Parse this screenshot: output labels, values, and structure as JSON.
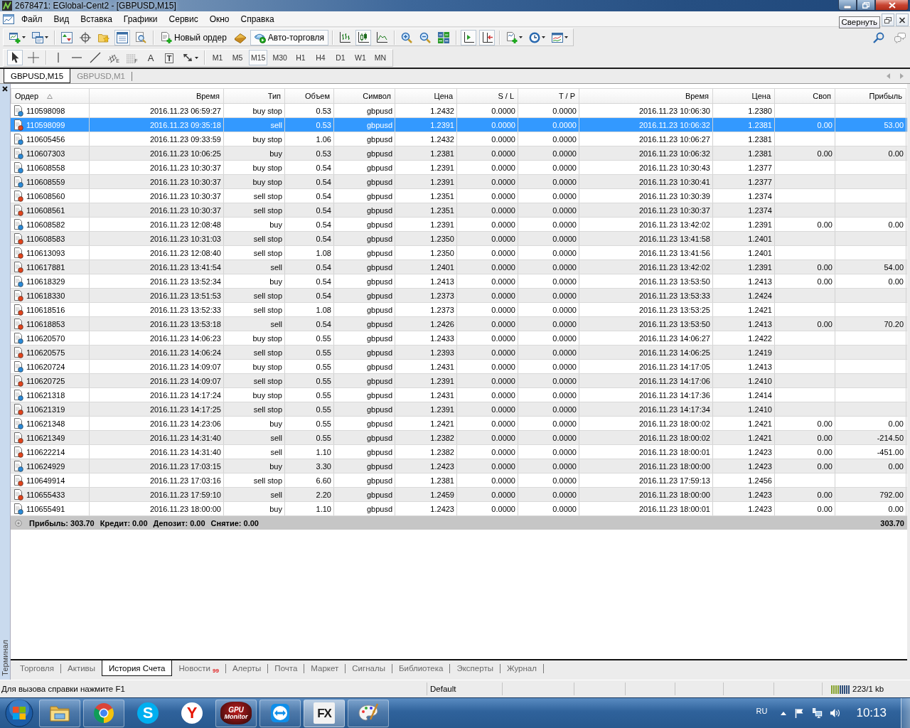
{
  "window": {
    "title": "2678471: EGlobal-Cent2 - [GBPUSD,M15]"
  },
  "menu": {
    "items": [
      "Файл",
      "Вид",
      "Вставка",
      "Графики",
      "Сервис",
      "Окно",
      "Справка"
    ],
    "tooltip": "Свернуть"
  },
  "toolbar": {
    "groups": [
      [
        {
          "kind": "new-chart",
          "pressed": false,
          "dropdown": true
        },
        {
          "kind": "profiles",
          "pressed": false,
          "dropdown": true
        }
      ],
      [
        {
          "kind": "market-watch",
          "pressed": false
        },
        {
          "kind": "data-window",
          "pressed": false
        },
        {
          "kind": "navigator",
          "pressed": false
        },
        {
          "kind": "terminal",
          "pressed": true
        },
        {
          "kind": "tester",
          "pressed": false
        }
      ],
      [
        {
          "kind": "new-order",
          "label": "Новый ордер",
          "pressed": false
        },
        {
          "kind": "editor",
          "pressed": false
        },
        {
          "kind": "autotrading",
          "label": "Авто-торговля",
          "pressed": true
        }
      ],
      [
        {
          "kind": "bars",
          "pressed": false
        },
        {
          "kind": "candles",
          "pressed": true
        },
        {
          "kind": "line",
          "pressed": false
        }
      ],
      [
        {
          "kind": "zoom-in",
          "pressed": false
        },
        {
          "kind": "zoom-out",
          "pressed": false
        },
        {
          "kind": "tile",
          "pressed": false
        }
      ],
      [
        {
          "kind": "shift",
          "pressed": true
        },
        {
          "kind": "autoscroll",
          "pressed": true
        }
      ],
      [
        {
          "kind": "indicators",
          "pressed": false,
          "dropdown": true
        },
        {
          "kind": "periods",
          "pressed": false,
          "dropdown": true
        },
        {
          "kind": "templates",
          "pressed": false,
          "dropdown": true
        }
      ]
    ],
    "right": [
      {
        "kind": "search"
      },
      {
        "kind": "chat"
      }
    ]
  },
  "drawing_toolbar": {
    "groups": [
      [
        {
          "kind": "cursor",
          "selected": true
        },
        {
          "kind": "crosshair",
          "selected": false
        }
      ],
      [
        {
          "kind": "vline",
          "selected": false
        },
        {
          "kind": "hline",
          "selected": false
        },
        {
          "kind": "trendline",
          "selected": false
        },
        {
          "kind": "channel",
          "letter": "E",
          "selected": false
        },
        {
          "kind": "fibo",
          "letter": "F",
          "selected": false
        },
        {
          "kind": "text",
          "letter": "A",
          "selected": false
        },
        {
          "kind": "label",
          "letter": "T",
          "selected": false
        },
        {
          "kind": "arrows",
          "selected": false,
          "dropdown": true
        }
      ]
    ],
    "timeframes": [
      {
        "label": "M1",
        "selected": false
      },
      {
        "label": "M5",
        "selected": false
      },
      {
        "label": "M15",
        "selected": true
      },
      {
        "label": "M30",
        "selected": false
      },
      {
        "label": "H1",
        "selected": false
      },
      {
        "label": "H4",
        "selected": false
      },
      {
        "label": "D1",
        "selected": false
      },
      {
        "label": "W1",
        "selected": false
      },
      {
        "label": "MN",
        "selected": false
      }
    ]
  },
  "chart_tabs": [
    {
      "label": "GBPUSD,M15",
      "selected": true
    },
    {
      "label": "GBPUSD,M1",
      "selected": false
    }
  ],
  "terminal": {
    "title": "Терминал",
    "table": {
      "columns": [
        {
          "label": "Ордер",
          "sorted": true
        },
        {
          "label": "Время",
          "sorted": false
        },
        {
          "label": "Тип",
          "sorted": false
        },
        {
          "label": "Объем",
          "sorted": false
        },
        {
          "label": "Символ",
          "sorted": false
        },
        {
          "label": "Цена",
          "sorted": false
        },
        {
          "label": "S / L",
          "sorted": false
        },
        {
          "label": "T / P",
          "sorted": false
        },
        {
          "label": "Время",
          "sorted": false
        },
        {
          "label": "Цена",
          "sorted": false
        },
        {
          "label": "Своп",
          "sorted": false
        },
        {
          "label": "Прибыль",
          "sorted": false
        }
      ],
      "rows": [
        {
          "order": "110598098",
          "open_time": "2016.11.23 06:59:27",
          "type": "buy stop",
          "volume": "0.53",
          "symbol": "gbpusd",
          "open_price": "1.2432",
          "sl": "0.0000",
          "tp": "0.0000",
          "close_time": "2016.11.23 10:06:30",
          "close_price": "1.2380",
          "kind": "buy",
          "selected": false
        },
        {
          "order": "110598099",
          "open_time": "2016.11.23 09:35:18",
          "type": "sell",
          "volume": "0.53",
          "symbol": "gbpusd",
          "open_price": "1.2391",
          "sl": "0.0000",
          "tp": "0.0000",
          "close_time": "2016.11.23 10:06:32",
          "close_price": "1.2381",
          "swap": "0.00",
          "profit": "53.00",
          "kind": "sell",
          "selected": true
        },
        {
          "order": "110605456",
          "open_time": "2016.11.23 09:33:59",
          "type": "buy stop",
          "volume": "1.06",
          "symbol": "gbpusd",
          "open_price": "1.2432",
          "sl": "0.0000",
          "tp": "0.0000",
          "close_time": "2016.11.23 10:06:27",
          "close_price": "1.2381",
          "kind": "buy",
          "selected": false
        },
        {
          "order": "110607303",
          "open_time": "2016.11.23 10:06:25",
          "type": "buy",
          "volume": "0.53",
          "symbol": "gbpusd",
          "open_price": "1.2381",
          "sl": "0.0000",
          "tp": "0.0000",
          "close_time": "2016.11.23 10:06:32",
          "close_price": "1.2381",
          "swap": "0.00",
          "profit": "0.00",
          "kind": "buy",
          "selected": false
        },
        {
          "order": "110608558",
          "open_time": "2016.11.23 10:30:37",
          "type": "buy stop",
          "volume": "0.54",
          "symbol": "gbpusd",
          "open_price": "1.2391",
          "sl": "0.0000",
          "tp": "0.0000",
          "close_time": "2016.11.23 10:30:43",
          "close_price": "1.2377",
          "kind": "buy",
          "selected": false
        },
        {
          "order": "110608559",
          "open_time": "2016.11.23 10:30:37",
          "type": "buy stop",
          "volume": "0.54",
          "symbol": "gbpusd",
          "open_price": "1.2391",
          "sl": "0.0000",
          "tp": "0.0000",
          "close_time": "2016.11.23 10:30:41",
          "close_price": "1.2377",
          "kind": "buy",
          "selected": false
        },
        {
          "order": "110608560",
          "open_time": "2016.11.23 10:30:37",
          "type": "sell stop",
          "volume": "0.54",
          "symbol": "gbpusd",
          "open_price": "1.2351",
          "sl": "0.0000",
          "tp": "0.0000",
          "close_time": "2016.11.23 10:30:39",
          "close_price": "1.2374",
          "kind": "sell",
          "selected": false
        },
        {
          "order": "110608561",
          "open_time": "2016.11.23 10:30:37",
          "type": "sell stop",
          "volume": "0.54",
          "symbol": "gbpusd",
          "open_price": "1.2351",
          "sl": "0.0000",
          "tp": "0.0000",
          "close_time": "2016.11.23 10:30:37",
          "close_price": "1.2374",
          "kind": "sell",
          "selected": false
        },
        {
          "order": "110608582",
          "open_time": "2016.11.23 12:08:48",
          "type": "buy",
          "volume": "0.54",
          "symbol": "gbpusd",
          "open_price": "1.2391",
          "sl": "0.0000",
          "tp": "0.0000",
          "close_time": "2016.11.23 13:42:02",
          "close_price": "1.2391",
          "swap": "0.00",
          "profit": "0.00",
          "kind": "buy",
          "selected": false
        },
        {
          "order": "110608583",
          "open_time": "2016.11.23 10:31:03",
          "type": "sell stop",
          "volume": "0.54",
          "symbol": "gbpusd",
          "open_price": "1.2350",
          "sl": "0.0000",
          "tp": "0.0000",
          "close_time": "2016.11.23 13:41:58",
          "close_price": "1.2401",
          "kind": "sell",
          "selected": false
        },
        {
          "order": "110613093",
          "open_time": "2016.11.23 12:08:40",
          "type": "sell stop",
          "volume": "1.08",
          "symbol": "gbpusd",
          "open_price": "1.2350",
          "sl": "0.0000",
          "tp": "0.0000",
          "close_time": "2016.11.23 13:41:56",
          "close_price": "1.2401",
          "kind": "sell",
          "selected": false
        },
        {
          "order": "110617881",
          "open_time": "2016.11.23 13:41:54",
          "type": "sell",
          "volume": "0.54",
          "symbol": "gbpusd",
          "open_price": "1.2401",
          "sl": "0.0000",
          "tp": "0.0000",
          "close_time": "2016.11.23 13:42:02",
          "close_price": "1.2391",
          "swap": "0.00",
          "profit": "54.00",
          "kind": "sell",
          "selected": false
        },
        {
          "order": "110618329",
          "open_time": "2016.11.23 13:52:34",
          "type": "buy",
          "volume": "0.54",
          "symbol": "gbpusd",
          "open_price": "1.2413",
          "sl": "0.0000",
          "tp": "0.0000",
          "close_time": "2016.11.23 13:53:50",
          "close_price": "1.2413",
          "swap": "0.00",
          "profit": "0.00",
          "kind": "buy",
          "selected": false
        },
        {
          "order": "110618330",
          "open_time": "2016.11.23 13:51:53",
          "type": "sell stop",
          "volume": "0.54",
          "symbol": "gbpusd",
          "open_price": "1.2373",
          "sl": "0.0000",
          "tp": "0.0000",
          "close_time": "2016.11.23 13:53:33",
          "close_price": "1.2424",
          "kind": "sell",
          "selected": false
        },
        {
          "order": "110618516",
          "open_time": "2016.11.23 13:52:33",
          "type": "sell stop",
          "volume": "1.08",
          "symbol": "gbpusd",
          "open_price": "1.2373",
          "sl": "0.0000",
          "tp": "0.0000",
          "close_time": "2016.11.23 13:53:25",
          "close_price": "1.2421",
          "kind": "sell",
          "selected": false
        },
        {
          "order": "110618853",
          "open_time": "2016.11.23 13:53:18",
          "type": "sell",
          "volume": "0.54",
          "symbol": "gbpusd",
          "open_price": "1.2426",
          "sl": "0.0000",
          "tp": "0.0000",
          "close_time": "2016.11.23 13:53:50",
          "close_price": "1.2413",
          "swap": "0.00",
          "profit": "70.20",
          "kind": "sell",
          "selected": false
        },
        {
          "order": "110620570",
          "open_time": "2016.11.23 14:06:23",
          "type": "buy stop",
          "volume": "0.55",
          "symbol": "gbpusd",
          "open_price": "1.2433",
          "sl": "0.0000",
          "tp": "0.0000",
          "close_time": "2016.11.23 14:06:27",
          "close_price": "1.2422",
          "kind": "buy",
          "selected": false
        },
        {
          "order": "110620575",
          "open_time": "2016.11.23 14:06:24",
          "type": "sell stop",
          "volume": "0.55",
          "symbol": "gbpusd",
          "open_price": "1.2393",
          "sl": "0.0000",
          "tp": "0.0000",
          "close_time": "2016.11.23 14:06:25",
          "close_price": "1.2419",
          "kind": "sell",
          "selected": false
        },
        {
          "order": "110620724",
          "open_time": "2016.11.23 14:09:07",
          "type": "buy stop",
          "volume": "0.55",
          "symbol": "gbpusd",
          "open_price": "1.2431",
          "sl": "0.0000",
          "tp": "0.0000",
          "close_time": "2016.11.23 14:17:05",
          "close_price": "1.2413",
          "kind": "buy",
          "selected": false
        },
        {
          "order": "110620725",
          "open_time": "2016.11.23 14:09:07",
          "type": "sell stop",
          "volume": "0.55",
          "symbol": "gbpusd",
          "open_price": "1.2391",
          "sl": "0.0000",
          "tp": "0.0000",
          "close_time": "2016.11.23 14:17:06",
          "close_price": "1.2410",
          "kind": "sell",
          "selected": false
        },
        {
          "order": "110621318",
          "open_time": "2016.11.23 14:17:24",
          "type": "buy stop",
          "volume": "0.55",
          "symbol": "gbpusd",
          "open_price": "1.2431",
          "sl": "0.0000",
          "tp": "0.0000",
          "close_time": "2016.11.23 14:17:36",
          "close_price": "1.2414",
          "kind": "buy",
          "selected": false
        },
        {
          "order": "110621319",
          "open_time": "2016.11.23 14:17:25",
          "type": "sell stop",
          "volume": "0.55",
          "symbol": "gbpusd",
          "open_price": "1.2391",
          "sl": "0.0000",
          "tp": "0.0000",
          "close_time": "2016.11.23 14:17:34",
          "close_price": "1.2410",
          "kind": "sell",
          "selected": false
        },
        {
          "order": "110621348",
          "open_time": "2016.11.23 14:23:06",
          "type": "buy",
          "volume": "0.55",
          "symbol": "gbpusd",
          "open_price": "1.2421",
          "sl": "0.0000",
          "tp": "0.0000",
          "close_time": "2016.11.23 18:00:02",
          "close_price": "1.2421",
          "swap": "0.00",
          "profit": "0.00",
          "kind": "buy",
          "selected": false
        },
        {
          "order": "110621349",
          "open_time": "2016.11.23 14:31:40",
          "type": "sell",
          "volume": "0.55",
          "symbol": "gbpusd",
          "open_price": "1.2382",
          "sl": "0.0000",
          "tp": "0.0000",
          "close_time": "2016.11.23 18:00:02",
          "close_price": "1.2421",
          "swap": "0.00",
          "profit": "-214.50",
          "kind": "sell",
          "selected": false
        },
        {
          "order": "110622214",
          "open_time": "2016.11.23 14:31:40",
          "type": "sell",
          "volume": "1.10",
          "symbol": "gbpusd",
          "open_price": "1.2382",
          "sl": "0.0000",
          "tp": "0.0000",
          "close_time": "2016.11.23 18:00:01",
          "close_price": "1.2423",
          "swap": "0.00",
          "profit": "-451.00",
          "kind": "sell",
          "selected": false
        },
        {
          "order": "110624929",
          "open_time": "2016.11.23 17:03:15",
          "type": "buy",
          "volume": "3.30",
          "symbol": "gbpusd",
          "open_price": "1.2423",
          "sl": "0.0000",
          "tp": "0.0000",
          "close_time": "2016.11.23 18:00:00",
          "close_price": "1.2423",
          "swap": "0.00",
          "profit": "0.00",
          "kind": "buy",
          "selected": false
        },
        {
          "order": "110649914",
          "open_time": "2016.11.23 17:03:16",
          "type": "sell stop",
          "volume": "6.60",
          "symbol": "gbpusd",
          "open_price": "1.2381",
          "sl": "0.0000",
          "tp": "0.0000",
          "close_time": "2016.11.23 17:59:13",
          "close_price": "1.2456",
          "kind": "sell",
          "selected": false
        },
        {
          "order": "110655433",
          "open_time": "2016.11.23 17:59:10",
          "type": "sell",
          "volume": "2.20",
          "symbol": "gbpusd",
          "open_price": "1.2459",
          "sl": "0.0000",
          "tp": "0.0000",
          "close_time": "2016.11.23 18:00:00",
          "close_price": "1.2423",
          "swap": "0.00",
          "profit": "792.00",
          "kind": "sell",
          "selected": false
        },
        {
          "order": "110655491",
          "open_time": "2016.11.23 18:00:00",
          "type": "buy",
          "volume": "1.10",
          "symbol": "gbpusd",
          "open_price": "1.2423",
          "sl": "0.0000",
          "tp": "0.0000",
          "close_time": "2016.11.23 18:00:01",
          "close_price": "1.2423",
          "swap": "0.00",
          "profit": "0.00",
          "kind": "buy",
          "selected": false
        }
      ],
      "summary": {
        "items": [
          "Прибыль: 303.70",
          "Кредит: 0.00",
          "Депозит: 0.00",
          "Снятие: 0.00"
        ],
        "total": "303.70"
      }
    },
    "tabs": [
      {
        "label": "Торговля",
        "selected": false
      },
      {
        "label": "Активы",
        "selected": false
      },
      {
        "label": "История Счета",
        "selected": true
      },
      {
        "label": "Новости",
        "badge": "99",
        "selected": false
      },
      {
        "label": "Алерты",
        "selected": false
      },
      {
        "label": "Почта",
        "selected": false
      },
      {
        "label": "Маркет",
        "selected": false
      },
      {
        "label": "Сигналы",
        "selected": false
      },
      {
        "label": "Библиотека",
        "selected": false
      },
      {
        "label": "Эксперты",
        "selected": false
      },
      {
        "label": "Журнал",
        "selected": false
      }
    ]
  },
  "status_bar": {
    "help": "Для вызова справки нажмите F1",
    "profile": "Default",
    "traffic": "223/1 kb"
  },
  "taskbar": {
    "apps": [
      {
        "kind": "explorer",
        "running": true,
        "selected": false
      },
      {
        "kind": "chrome",
        "running": true,
        "selected": false
      },
      {
        "kind": "skype",
        "label": "S",
        "running": false,
        "selected": false
      },
      {
        "kind": "yandex",
        "label": "Y",
        "running": false,
        "selected": false
      },
      {
        "kind": "gpu",
        "label": "GPU",
        "caption": "Monitor",
        "running": true,
        "selected": false
      },
      {
        "kind": "teamviewer",
        "running": true,
        "selected": false
      },
      {
        "kind": "fx",
        "label": "FX",
        "running": true,
        "selected": true
      },
      {
        "kind": "paint",
        "running": true,
        "selected": false
      }
    ],
    "tray": {
      "language": "RU",
      "clock": "10:13"
    }
  }
}
